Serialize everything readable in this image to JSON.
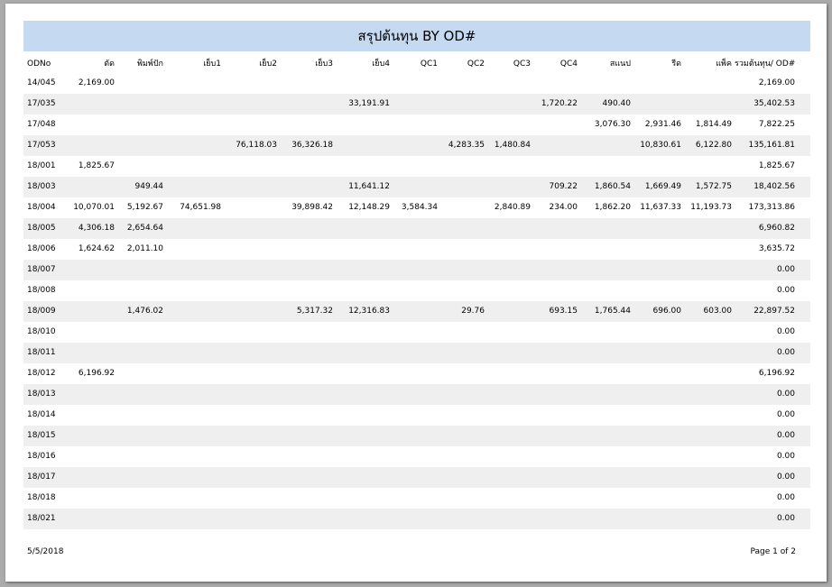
{
  "report": {
    "title": "สรุปต้นทุน BY OD#",
    "columns": [
      "ODNo",
      "ตัด",
      "พิมพ์ปัก",
      "เย็บ1",
      "เย็บ2",
      "เย็บ3",
      "เย็บ4",
      "QC1",
      "QC2",
      "QC3",
      "QC4",
      "สแนป",
      "รีด",
      "แพ็ค",
      "รวมต้นทุน/ OD#"
    ],
    "rows": [
      [
        "14/045",
        "2,169.00",
        "",
        "",
        "",
        "",
        "",
        "",
        "",
        "",
        "",
        "",
        "",
        "",
        "2,169.00"
      ],
      [
        "17/035",
        "",
        "",
        "",
        "",
        "",
        "33,191.91",
        "",
        "",
        "",
        "1,720.22",
        "490.40",
        "",
        "",
        "35,402.53"
      ],
      [
        "17/048",
        "",
        "",
        "",
        "",
        "",
        "",
        "",
        "",
        "",
        "",
        "3,076.30",
        "2,931.46",
        "1,814.49",
        "7,822.25"
      ],
      [
        "17/053",
        "",
        "",
        "",
        "76,118.03",
        "36,326.18",
        "",
        "",
        "4,283.35",
        "1,480.84",
        "",
        "",
        "10,830.61",
        "6,122.80",
        "135,161.81"
      ],
      [
        "18/001",
        "1,825.67",
        "",
        "",
        "",
        "",
        "",
        "",
        "",
        "",
        "",
        "",
        "",
        "",
        "1,825.67"
      ],
      [
        "18/003",
        "",
        "949.44",
        "",
        "",
        "",
        "11,641.12",
        "",
        "",
        "",
        "709.22",
        "1,860.54",
        "1,669.49",
        "1,572.75",
        "18,402.56"
      ],
      [
        "18/004",
        "10,070.01",
        "5,192.67",
        "74,651.98",
        "",
        "39,898.42",
        "12,148.29",
        "3,584.34",
        "",
        "2,840.89",
        "234.00",
        "1,862.20",
        "11,637.33",
        "11,193.73",
        "173,313.86"
      ],
      [
        "18/005",
        "4,306.18",
        "2,654.64",
        "",
        "",
        "",
        "",
        "",
        "",
        "",
        "",
        "",
        "",
        "",
        "6,960.82"
      ],
      [
        "18/006",
        "1,624.62",
        "2,011.10",
        "",
        "",
        "",
        "",
        "",
        "",
        "",
        "",
        "",
        "",
        "",
        "3,635.72"
      ],
      [
        "18/007",
        "",
        "",
        "",
        "",
        "",
        "",
        "",
        "",
        "",
        "",
        "",
        "",
        "",
        "0.00"
      ],
      [
        "18/008",
        "",
        "",
        "",
        "",
        "",
        "",
        "",
        "",
        "",
        "",
        "",
        "",
        "",
        "0.00"
      ],
      [
        "18/009",
        "",
        "1,476.02",
        "",
        "",
        "5,317.32",
        "12,316.83",
        "",
        "29.76",
        "",
        "693.15",
        "1,765.44",
        "696.00",
        "603.00",
        "22,897.52"
      ],
      [
        "18/010",
        "",
        "",
        "",
        "",
        "",
        "",
        "",
        "",
        "",
        "",
        "",
        "",
        "",
        "0.00"
      ],
      [
        "18/011",
        "",
        "",
        "",
        "",
        "",
        "",
        "",
        "",
        "",
        "",
        "",
        "",
        "",
        "0.00"
      ],
      [
        "18/012",
        "6,196.92",
        "",
        "",
        "",
        "",
        "",
        "",
        "",
        "",
        "",
        "",
        "",
        "",
        "6,196.92"
      ],
      [
        "18/013",
        "",
        "",
        "",
        "",
        "",
        "",
        "",
        "",
        "",
        "",
        "",
        "",
        "",
        "0.00"
      ],
      [
        "18/014",
        "",
        "",
        "",
        "",
        "",
        "",
        "",
        "",
        "",
        "",
        "",
        "",
        "",
        "0.00"
      ],
      [
        "18/015",
        "",
        "",
        "",
        "",
        "",
        "",
        "",
        "",
        "",
        "",
        "",
        "",
        "",
        "0.00"
      ],
      [
        "18/016",
        "",
        "",
        "",
        "",
        "",
        "",
        "",
        "",
        "",
        "",
        "",
        "",
        "",
        "0.00"
      ],
      [
        "18/017",
        "",
        "",
        "",
        "",
        "",
        "",
        "",
        "",
        "",
        "",
        "",
        "",
        "",
        "0.00"
      ],
      [
        "18/018",
        "",
        "",
        "",
        "",
        "",
        "",
        "",
        "",
        "",
        "",
        "",
        "",
        "",
        "0.00"
      ],
      [
        "18/021",
        "",
        "",
        "",
        "",
        "",
        "",
        "",
        "",
        "",
        "",
        "",
        "",
        "",
        "0.00"
      ]
    ]
  },
  "footer": {
    "date": "5/5/2018",
    "page": "Page 1 of 2"
  },
  "colors": {
    "title_bg": "#c5d9f1",
    "row_shade": "#efefef",
    "backdrop": "#ababab"
  }
}
